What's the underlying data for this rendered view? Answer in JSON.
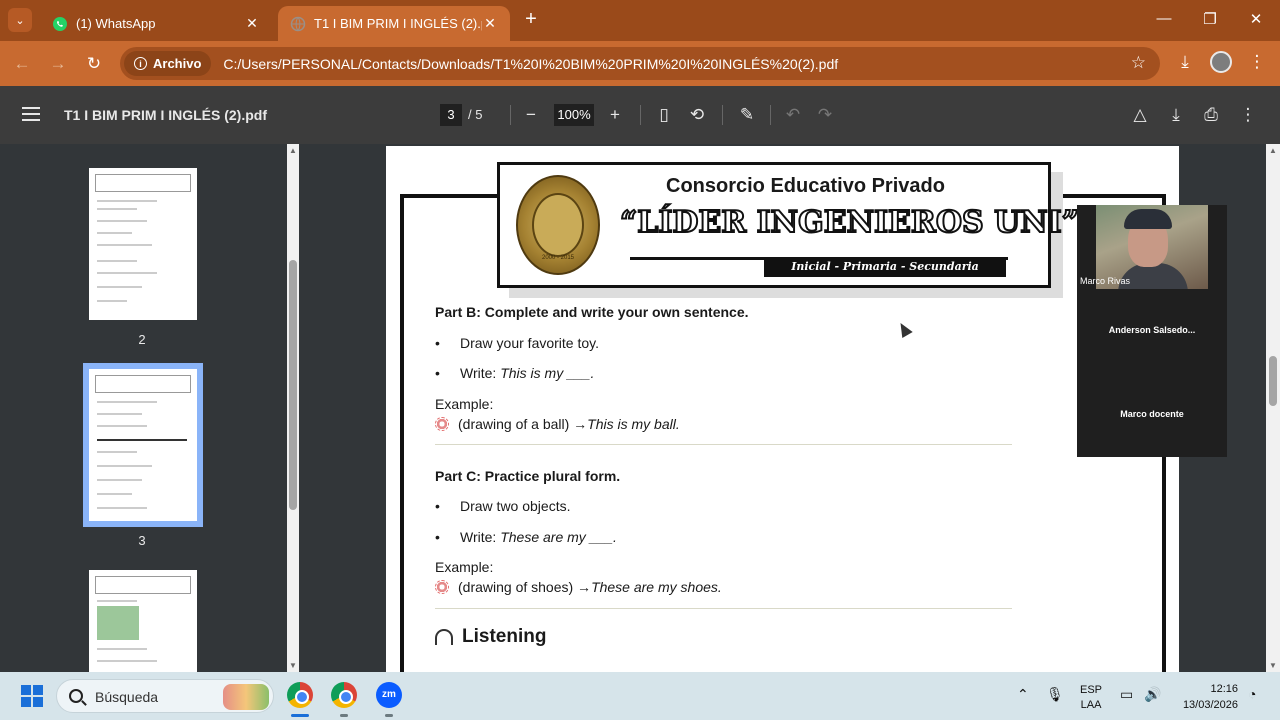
{
  "browser": {
    "tabs": [
      {
        "label": "(1) WhatsApp",
        "active": false
      },
      {
        "label": "T1 I BIM PRIM I INGLÉS (2).pdf",
        "active": true
      }
    ],
    "chip_label": "Archivo",
    "url": "C:/Users/PERSONAL/Contacts/Downloads/T1%20I%20BIM%20PRIM%20I%20INGLÉS%20(2).pdf",
    "icons": {
      "back": "arrow-left-icon",
      "forward": "arrow-right-icon",
      "reload": "reload-icon",
      "bookmark": "star-icon",
      "download": "download-icon",
      "menu": "kebab-icon"
    }
  },
  "pdf": {
    "title": "T1 I BIM PRIM I INGLÉS (2).pdf",
    "current_page": "3",
    "total_pages": "/ 5",
    "zoom": "100%",
    "thumbnails": [
      {
        "num": "2"
      },
      {
        "num": "3",
        "selected": true
      },
      {
        "num": ""
      }
    ]
  },
  "document": {
    "banner": {
      "line1": "Consorcio Educativo Privado",
      "line2": "“LÍDER INGENIEROS UNI”",
      "line3": "Inicial - Primaria - Secundaria",
      "seal_year": "2000 - 2015"
    },
    "part_b": {
      "title": "Part B: Complete and write your own sentence.",
      "bullet1": "Draw your favorite toy.",
      "bullet2_prefix": "Write: ",
      "bullet2_italic": "This is my ___.",
      "example_label": "Example:",
      "example_text": "(drawing of a ball) → ",
      "example_italic": "This is my ball."
    },
    "part_c": {
      "title": "Part C: Practice plural form.",
      "bullet1": "Draw two objects.",
      "bullet2_prefix": "Write: ",
      "bullet2_italic": "These are my ___.",
      "example_label": "Example:",
      "example_text": "(drawing of shoes) → ",
      "example_italic": "These are my shoes."
    },
    "listening": "Listening",
    "bullet_char": "•"
  },
  "zoom": {
    "participants": [
      "Marco Rivas",
      "Anderson  Salsedo...",
      "Marco docente"
    ]
  },
  "taskbar": {
    "search_placeholder": "Búsqueda",
    "zoom_label": "zm",
    "lang_line1": "ESP",
    "lang_line2": "LAA",
    "time": "12:16",
    "date": "13/03/2026"
  },
  "colors": {
    "tabstrip": "#9a4a1a",
    "toolbar": "#c86a30",
    "pdf_toolbar": "#3c3c3c",
    "viewer_bg": "#323639",
    "selected_thumb": "#8ab4f8"
  }
}
